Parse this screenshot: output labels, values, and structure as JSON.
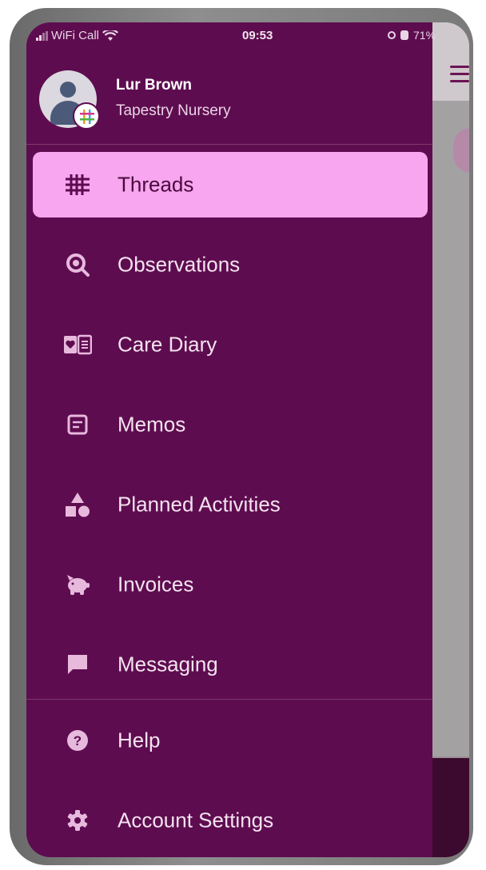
{
  "status_bar": {
    "carrier": "WiFi Call",
    "time": "09:53",
    "battery": "71%"
  },
  "profile": {
    "name": "Lur Brown",
    "organisation": "Tapestry Nursery"
  },
  "menu": {
    "items": [
      {
        "label": "Threads",
        "icon": "threads-grid-icon",
        "active": true
      },
      {
        "label": "Observations",
        "icon": "observations-magnifier-icon"
      },
      {
        "label": "Care Diary",
        "icon": "care-diary-book-icon"
      },
      {
        "label": "Memos",
        "icon": "memo-icon"
      },
      {
        "label": "Planned Activities",
        "icon": "shapes-icon"
      },
      {
        "label": "Invoices",
        "icon": "piggy-bank-icon"
      },
      {
        "label": "Messaging",
        "icon": "chat-bubble-icon"
      }
    ],
    "footer_items": [
      {
        "label": "Help",
        "icon": "help-icon"
      },
      {
        "label": "Account Settings",
        "icon": "gear-icon"
      }
    ]
  },
  "colors": {
    "drawer_background": "#5e0c50",
    "active_item_background": "#f8a6ef",
    "active_item_text": "#4a0a3e",
    "item_text": "#f3e3ee",
    "icon_color": "#e7b9dd"
  }
}
